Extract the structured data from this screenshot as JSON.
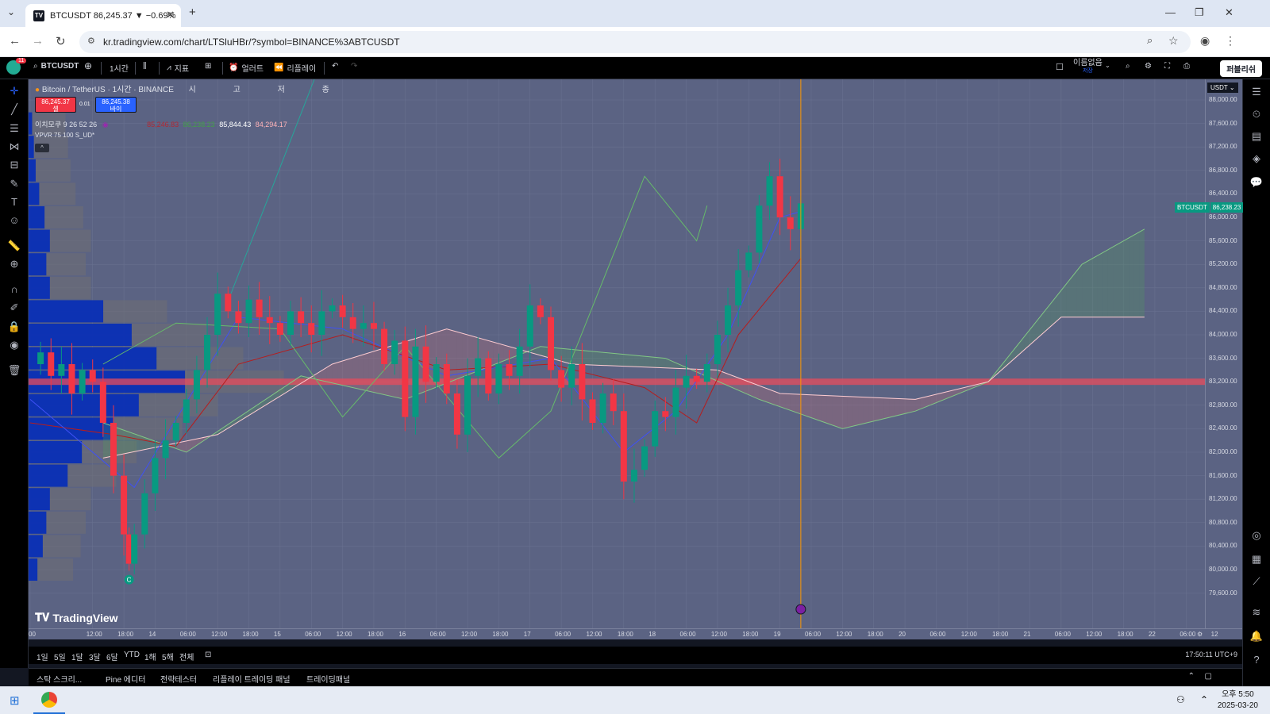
{
  "browser": {
    "tab_title": "BTCUSDT 86,245.37 ▼ −0.69%",
    "tab_favicon": "TV",
    "new_tab": "+",
    "url": "kr.tradingview.com/chart/LTSluHBr/?symbol=BINANCE%3ABTCUSDT"
  },
  "toolbar": {
    "avatar_badge": "11",
    "symbol": "BTCUSDT",
    "interval": "1시간",
    "indicators": "지표",
    "alert": "얼러트",
    "replay": "리플레이",
    "layout_name": "이름없음",
    "layout_sub": "저장",
    "publish": "퍼블리쉬"
  },
  "legend": {
    "title": "Bitcoin / TetherUS · 1시간 · BINANCE",
    "open_label": "시",
    "high_label": "고",
    "low_label": "저",
    "close_label": "종",
    "sell_price": "86,245.37",
    "sell_label": "셀",
    "spread": "0.01",
    "buy_price": "86,245.38",
    "buy_label": "바이",
    "ichimoku_label": "이치모쿠 9 26 52 26",
    "ichimoku_v1": "85,246.83",
    "ichimoku_v2": "86,238.23",
    "ichimoku_v3": "85,844.43",
    "ichimoku_v4": "84,294.17",
    "vpvr_label": "VPVR 75 100 S_UD*",
    "collapse": "^"
  },
  "chart_data": {
    "type": "candlestick",
    "symbol": "BTCUSDT",
    "exchange": "BINANCE",
    "interval": "1h",
    "currency": "USDT",
    "last_price": "86,238.23",
    "y_ticks": [
      "88,000.00",
      "87,600.00",
      "87,200.00",
      "86,800.00",
      "86,400.00",
      "86,000.00",
      "85,600.00",
      "85,200.00",
      "84,800.00",
      "84,400.00",
      "84,000.00",
      "83,600.00",
      "83,200.00",
      "82,800.00",
      "82,400.00",
      "82,000.00",
      "81,600.00",
      "81,200.00",
      "80,800.00",
      "80,400.00",
      "80,000.00",
      "79,600.00"
    ],
    "ylim": [
      79400,
      88200
    ],
    "x_ticks": [
      "00",
      "12:00",
      "18:00",
      "14",
      "06:00",
      "12:00",
      "18:00",
      "15",
      "06:00",
      "12:00",
      "18:00",
      "16",
      "06:00",
      "12:00",
      "18:00",
      "17",
      "06:00",
      "12:00",
      "18:00",
      "18",
      "06:00",
      "12:00",
      "18:00",
      "19",
      "06:00",
      "12:00",
      "18:00",
      "20",
      "06:00",
      "12:00",
      "18:00",
      "21",
      "06:00",
      "12:00",
      "18:00",
      "22",
      "06:00",
      "12"
    ],
    "x_ticks_hours": [
      0,
      12,
      18,
      24,
      30,
      36,
      42,
      48,
      54,
      60,
      66,
      72,
      78,
      84,
      90,
      96,
      102,
      108,
      114,
      120,
      126,
      132,
      138,
      144,
      150,
      156,
      162,
      168,
      174,
      180,
      186,
      192,
      198,
      204,
      210,
      216,
      222,
      228
    ],
    "marker_c": "C",
    "up_color": "#089981",
    "down_color": "#f23645",
    "close_series": [
      [
        0,
        83500
      ],
      [
        2,
        83700
      ],
      [
        4,
        83300
      ],
      [
        6,
        83500
      ],
      [
        8,
        83000
      ],
      [
        10,
        83400
      ],
      [
        12,
        83200
      ],
      [
        14,
        82500
      ],
      [
        16,
        81600
      ],
      [
        18,
        80600
      ],
      [
        19,
        80100
      ],
      [
        20,
        80600
      ],
      [
        22,
        81300
      ],
      [
        24,
        81900
      ],
      [
        26,
        82200
      ],
      [
        28,
        82500
      ],
      [
        30,
        82900
      ],
      [
        32,
        83400
      ],
      [
        34,
        84000
      ],
      [
        36,
        84700
      ],
      [
        38,
        84400
      ],
      [
        40,
        84200
      ],
      [
        42,
        84600
      ],
      [
        44,
        84300
      ],
      [
        46,
        84200
      ],
      [
        48,
        84000
      ],
      [
        50,
        84400
      ],
      [
        52,
        84200
      ],
      [
        54,
        84000
      ],
      [
        56,
        84400
      ],
      [
        58,
        84500
      ],
      [
        60,
        84300
      ],
      [
        62,
        84100
      ],
      [
        64,
        84200
      ],
      [
        66,
        84100
      ],
      [
        68,
        83500
      ],
      [
        70,
        83900
      ],
      [
        72,
        82600
      ],
      [
        74,
        83800
      ],
      [
        76,
        83200
      ],
      [
        78,
        83500
      ],
      [
        80,
        83000
      ],
      [
        82,
        82300
      ],
      [
        84,
        83300
      ],
      [
        86,
        83600
      ],
      [
        88,
        83000
      ],
      [
        90,
        83500
      ],
      [
        92,
        83300
      ],
      [
        94,
        83800
      ],
      [
        96,
        84500
      ],
      [
        98,
        84300
      ],
      [
        100,
        83400
      ],
      [
        102,
        83100
      ],
      [
        104,
        83500
      ],
      [
        106,
        82900
      ],
      [
        108,
        82500
      ],
      [
        110,
        83000
      ],
      [
        112,
        82700
      ],
      [
        114,
        81500
      ],
      [
        116,
        81700
      ],
      [
        118,
        82100
      ],
      [
        120,
        82700
      ],
      [
        122,
        82600
      ],
      [
        124,
        83100
      ],
      [
        126,
        83300
      ],
      [
        128,
        83200
      ],
      [
        130,
        83500
      ],
      [
        132,
        84000
      ],
      [
        134,
        84500
      ],
      [
        136,
        85100
      ],
      [
        138,
        85400
      ],
      [
        140,
        86200
      ],
      [
        142,
        86700
      ],
      [
        144,
        86000
      ],
      [
        146,
        85800
      ],
      [
        148,
        86238
      ]
    ],
    "tenkan_series": [
      [
        0,
        82900
      ],
      [
        20,
        81400
      ],
      [
        40,
        84300
      ],
      [
        60,
        84100
      ],
      [
        80,
        83300
      ],
      [
        100,
        83600
      ],
      [
        114,
        82000
      ],
      [
        124,
        82700
      ],
      [
        134,
        84000
      ],
      [
        144,
        86000
      ],
      [
        148,
        86100
      ]
    ],
    "kijun_series": [
      [
        0,
        82500
      ],
      [
        16,
        82300
      ],
      [
        28,
        82100
      ],
      [
        40,
        83500
      ],
      [
        60,
        84000
      ],
      [
        80,
        83400
      ],
      [
        100,
        83500
      ],
      [
        118,
        83100
      ],
      [
        128,
        82500
      ],
      [
        136,
        84000
      ],
      [
        148,
        85300
      ]
    ],
    "senkou_a_series": [
      [
        14,
        82500
      ],
      [
        30,
        82000
      ],
      [
        52,
        83300
      ],
      [
        72,
        82900
      ],
      [
        98,
        83800
      ],
      [
        122,
        83600
      ],
      [
        140,
        82900
      ],
      [
        156,
        82400
      ],
      [
        170,
        82700
      ],
      [
        184,
        83200
      ],
      [
        202,
        85200
      ],
      [
        214,
        85800
      ]
    ],
    "senkou_b_series": [
      [
        14,
        81900
      ],
      [
        36,
        82300
      ],
      [
        58,
        83500
      ],
      [
        80,
        84100
      ],
      [
        104,
        83500
      ],
      [
        132,
        83400
      ],
      [
        144,
        83000
      ],
      [
        170,
        82900
      ],
      [
        184,
        83200
      ],
      [
        198,
        84300
      ],
      [
        214,
        84300
      ]
    ],
    "chikou_series": [
      [
        14,
        83500
      ],
      [
        28,
        84200
      ],
      [
        48,
        84100
      ],
      [
        60,
        82600
      ],
      [
        72,
        83800
      ],
      [
        90,
        81900
      ],
      [
        100,
        82700
      ],
      [
        118,
        86700
      ],
      [
        128,
        85600
      ],
      [
        130,
        86200
      ]
    ],
    "poc_price": 83200,
    "volume_profile": [
      [
        87600,
        2
      ],
      [
        87200,
        3
      ],
      [
        86800,
        4
      ],
      [
        86400,
        6
      ],
      [
        86000,
        9
      ],
      [
        85600,
        12
      ],
      [
        85200,
        10
      ],
      [
        84800,
        12
      ],
      [
        84400,
        42
      ],
      [
        84000,
        58
      ],
      [
        83600,
        72
      ],
      [
        83200,
        88
      ],
      [
        82800,
        62
      ],
      [
        82400,
        48
      ],
      [
        82000,
        30
      ],
      [
        81600,
        22
      ],
      [
        81200,
        12
      ],
      [
        80800,
        10
      ],
      [
        80400,
        8
      ],
      [
        80000,
        5
      ]
    ]
  },
  "bottom": {
    "periods": [
      "1일",
      "5일",
      "1달",
      "3달",
      "6달",
      "YTD",
      "1해",
      "5해",
      "전체"
    ],
    "clock": "17:50:11 UTC+9",
    "panels": [
      "스탁 스크리...",
      "Pine 에디터",
      "전략테스터",
      "리플레이 트레이딩 패널",
      "트레이딩패널"
    ]
  },
  "taskbar": {
    "time": "오후 5:50",
    "date": "2025-03-20"
  },
  "logo": "TradingView"
}
